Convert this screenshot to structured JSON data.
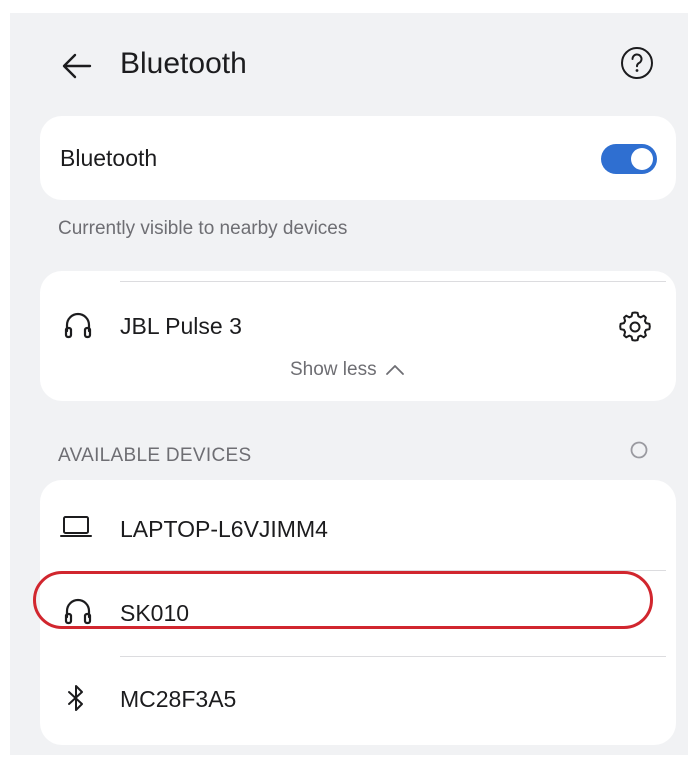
{
  "header": {
    "title": "Bluetooth"
  },
  "toggle_card": {
    "label": "Bluetooth",
    "enabled": true
  },
  "visibility_caption": "Currently visible to nearby devices",
  "paired": {
    "device_name": "JBL Pulse 3",
    "device_icon": "headphones-icon",
    "show_less_label": "Show less"
  },
  "available": {
    "section_title": "AVAILABLE DEVICES",
    "devices": [
      {
        "name": "LAPTOP-L6VJIMM4",
        "icon": "laptop-icon"
      },
      {
        "name": "SK010",
        "icon": "headphones-icon",
        "highlighted": true
      },
      {
        "name": "MC28F3A5",
        "icon": "bluetooth-icon"
      }
    ]
  },
  "colors": {
    "accent": "#2f6fd1",
    "highlight": "#d1262e",
    "background": "#f1f2f4",
    "card": "#ffffff"
  }
}
